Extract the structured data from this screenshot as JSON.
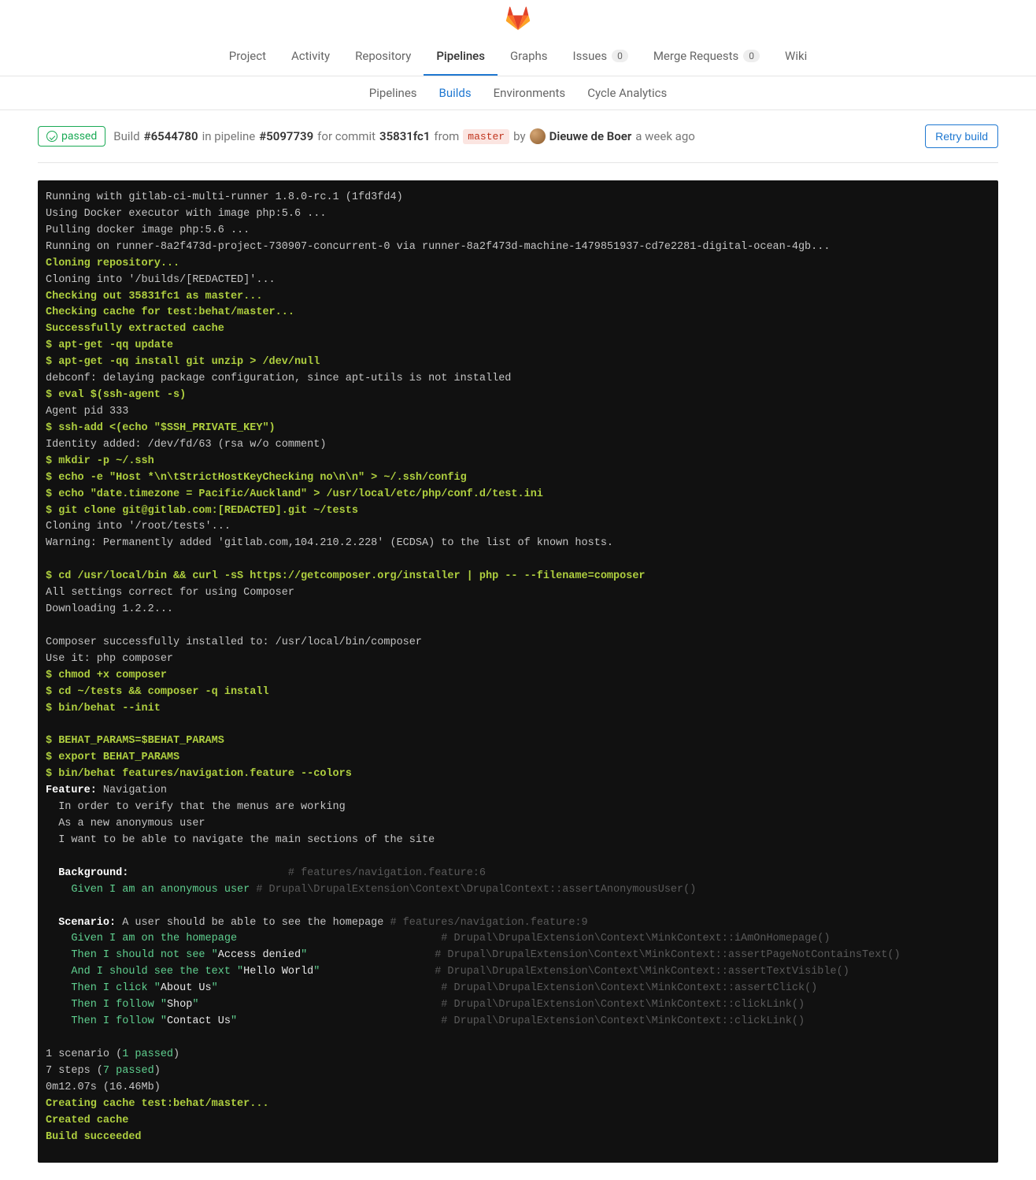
{
  "tabs": {
    "project": "Project",
    "activity": "Activity",
    "repository": "Repository",
    "pipelines": "Pipelines",
    "graphs": "Graphs",
    "issues": "Issues",
    "issues_count": "0",
    "merge_requests": "Merge Requests",
    "mr_count": "0",
    "wiki": "Wiki"
  },
  "subtabs": {
    "pipelines": "Pipelines",
    "builds": "Builds",
    "environments": "Environments",
    "cycle": "Cycle Analytics"
  },
  "status": "passed",
  "build": {
    "t_build": "Build ",
    "build_id": "#6544780",
    "t_inpipe": " in pipeline ",
    "pipeline_id": "#5097739",
    "t_forcommit": " for commit ",
    "commit": "35831fc1",
    "t_from": " from ",
    "branch": "master",
    "t_by": " by ",
    "author": "Dieuwe de Boer",
    "when": "a week ago"
  },
  "retry": "Retry build",
  "log": {
    "l1": "Running with gitlab-ci-multi-runner 1.8.0-rc.1 (1fd3fd4)",
    "l2": "Using Docker executor with image php:5.6 ...",
    "l3": "Pulling docker image php:5.6 ...",
    "l4": "Running on runner-8a2f473d-project-730907-concurrent-0 via runner-8a2f473d-machine-1479851937-cd7e2281-digital-ocean-4gb...",
    "l5": "Cloning repository...",
    "l6": "Cloning into '/builds/[REDACTED]'...",
    "l7": "Checking out 35831fc1 as master...",
    "l8": "Checking cache for test:behat/master...",
    "l9": "Successfully extracted cache",
    "l10": "$ apt-get -qq update",
    "l11": "$ apt-get -qq install git unzip > /dev/null",
    "l12": "debconf: delaying package configuration, since apt-utils is not installed",
    "l13": "$ eval $(ssh-agent -s)",
    "l14": "Agent pid 333",
    "l15": "$ ssh-add <(echo \"$SSH_PRIVATE_KEY\")",
    "l16": "Identity added: /dev/fd/63 (rsa w/o comment)",
    "l17": "$ mkdir -p ~/.ssh",
    "l18": "$ echo -e \"Host *\\n\\tStrictHostKeyChecking no\\n\\n\" > ~/.ssh/config",
    "l19": "$ echo \"date.timezone = Pacific/Auckland\" > /usr/local/etc/php/conf.d/test.ini",
    "l20": "$ git clone git@gitlab.com:[REDACTED].git ~/tests",
    "l21": "Cloning into '/root/tests'...",
    "l22": "Warning: Permanently added 'gitlab.com,104.210.2.228' (ECDSA) to the list of known hosts.",
    "l23": "$ cd /usr/local/bin && curl -sS https://getcomposer.org/installer | php -- --filename=composer",
    "l24": "All settings correct for using Composer",
    "l25": "Downloading 1.2.2...",
    "l26": "Composer successfully installed to: /usr/local/bin/composer",
    "l27": "Use it: php composer",
    "l28": "$ chmod +x composer",
    "l29": "$ cd ~/tests && composer -q install",
    "l30": "$ bin/behat --init",
    "l31": "$ BEHAT_PARAMS=$BEHAT_PARAMS",
    "l32": "$ export BEHAT_PARAMS",
    "l33": "$ bin/behat features/navigation.feature --colors",
    "feat_kw": "Feature:",
    "feat_name": " Navigation",
    "feat_l1": "  In order to verify that the menus are working",
    "feat_l2": "  As a new anonymous user",
    "feat_l3": "  I want to be able to navigate the main sections of the site",
    "bg_kw": "  Background:",
    "bg_loc": "                         # features/navigation.feature:6",
    "bg_step": "    Given I am an anonymous user",
    "bg_ctx": " # Drupal\\DrupalExtension\\Context\\DrupalContext::assertAnonymousUser()",
    "sc_kw": "  Scenario:",
    "sc_name": " A user should be able to see the homepage",
    "sc_loc": " # features/navigation.feature:9",
    "s1": "    Given I am on the homepage",
    "s1c": "                                # Drupal\\DrupalExtension\\Context\\MinkContext::iAmOnHomepage()",
    "s2a": "    Then I should not see \"",
    "s2b": "Access denied",
    "s2c": "\"",
    "s2ctx": "                    # Drupal\\DrupalExtension\\Context\\MinkContext::assertPageNotContainsText()",
    "s3a": "    And I should see the text \"",
    "s3b": "Hello World",
    "s3c": "\"",
    "s3ctx": "                  # Drupal\\DrupalExtension\\Context\\MinkContext::assertTextVisible()",
    "s4a": "    Then I click \"",
    "s4b": "About Us",
    "s4c": "\"",
    "s4ctx": "                                   # Drupal\\DrupalExtension\\Context\\MinkContext::assertClick()",
    "s5a": "    Then I follow \"",
    "s5b": "Shop",
    "s5c": "\"",
    "s5ctx": "                                      # Drupal\\DrupalExtension\\Context\\MinkContext::clickLink()",
    "s6a": "    Then I follow \"",
    "s6b": "Contact Us",
    "s6c": "\"",
    "s6ctx": "                                # Drupal\\DrupalExtension\\Context\\MinkContext::clickLink()",
    "res1a": "1 scenario (",
    "res1b": "1 passed",
    "res1c": ")",
    "res2a": "7 steps (",
    "res2b": "7 passed",
    "res2c": ")",
    "res3": "0m12.07s (16.46Mb)",
    "cache1": "Creating cache test:behat/master...",
    "cache2": "Created cache",
    "succ": "Build succeeded"
  }
}
